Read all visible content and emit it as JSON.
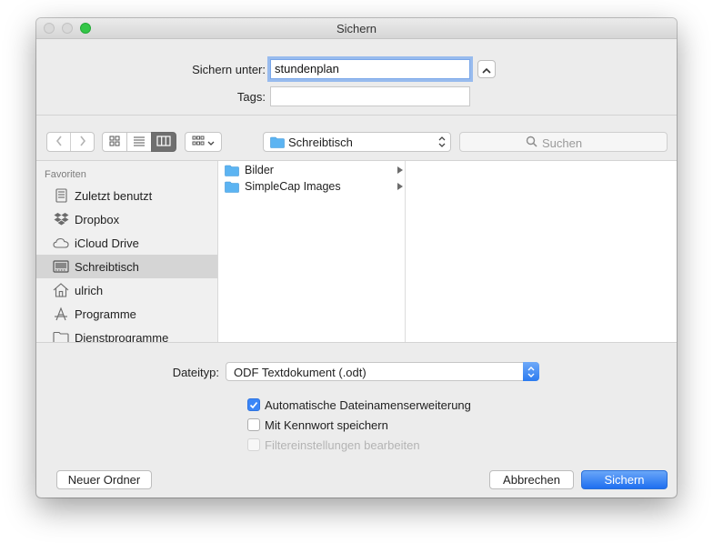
{
  "window": {
    "title": "Sichern"
  },
  "save": {
    "save_as_label": "Sichern unter:",
    "filename": "stundenplan",
    "tags_label": "Tags:",
    "tags_value": ""
  },
  "toolbar": {
    "location": "Schreibtisch",
    "search_placeholder": "Suchen",
    "view_mode": "columns"
  },
  "sidebar": {
    "header": "Favoriten",
    "items": [
      {
        "label": "Zuletzt benutzt",
        "icon": "recents-icon"
      },
      {
        "label": "Dropbox",
        "icon": "dropbox-icon"
      },
      {
        "label": "iCloud Drive",
        "icon": "cloud-icon"
      },
      {
        "label": "Schreibtisch",
        "icon": "desktop-icon",
        "selected": true
      },
      {
        "label": "ulrich",
        "icon": "home-icon"
      },
      {
        "label": "Programme",
        "icon": "applications-icon"
      },
      {
        "label": "Dienstprogramme",
        "icon": "folder-icon"
      }
    ]
  },
  "browser": {
    "column1": [
      {
        "label": "Bilder",
        "icon": "folder-icon"
      },
      {
        "label": "SimpleCap Images",
        "icon": "folder-icon"
      }
    ]
  },
  "options": {
    "filetype_label": "Dateityp:",
    "filetype_value": "ODF Textdokument (.odt)",
    "checkboxes": [
      {
        "label": "Automatische Dateinamenserweiterung",
        "checked": true,
        "enabled": true
      },
      {
        "label": "Mit Kennwort speichern",
        "checked": false,
        "enabled": true
      },
      {
        "label": "Filtereinstellungen bearbeiten",
        "checked": false,
        "enabled": false
      }
    ]
  },
  "buttons": {
    "new_folder": "Neuer Ordner",
    "cancel": "Abbrechen",
    "save": "Sichern"
  },
  "colors": {
    "accent": "#3b86f7",
    "folder": "#5cb4f2"
  }
}
